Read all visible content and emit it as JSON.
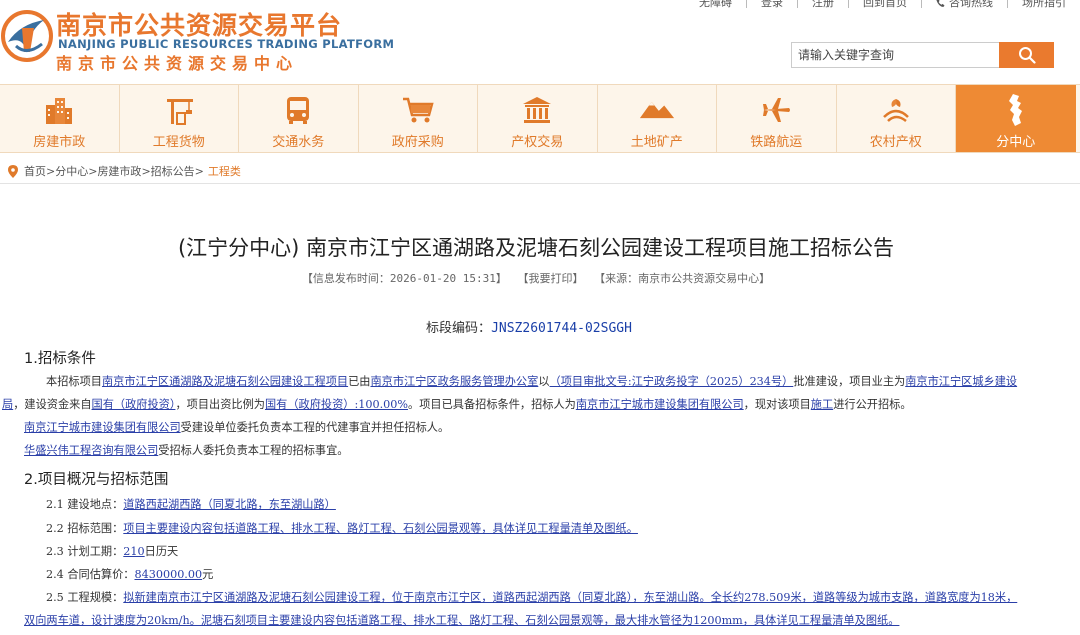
{
  "topbar": {
    "accessibility": "无障碍",
    "login": "登录",
    "register": "注册",
    "home": "回到首页",
    "hotline": "咨询热线",
    "venue_guide": "场所指引"
  },
  "brand": {
    "name_cn": "南京市公共资源交易平台",
    "name_en": "NANJING PUBLIC RESOURCES TRADING PLATFORM",
    "center_cn": "南京市公共资源交易中心"
  },
  "search": {
    "placeholder": "请输入关键字查询"
  },
  "nav": [
    {
      "label": "房建市政",
      "icon": "buildings-icon"
    },
    {
      "label": "工程货物",
      "icon": "crane-icon"
    },
    {
      "label": "交通水务",
      "icon": "bus-icon"
    },
    {
      "label": "政府采购",
      "icon": "cart-icon"
    },
    {
      "label": "产权交易",
      "icon": "bank-icon"
    },
    {
      "label": "土地矿产",
      "icon": "mountain-icon"
    },
    {
      "label": "铁路航运",
      "icon": "plane-icon"
    },
    {
      "label": "农村产权",
      "icon": "farm-icon"
    },
    {
      "label": "分中心",
      "icon": "map-icon"
    }
  ],
  "breadcrumb": {
    "items": [
      "首页",
      "分中心",
      "房建市政",
      "招标公告"
    ],
    "current": "工程类"
  },
  "article": {
    "title": "(江宁分中心) 南京市江宁区通湖路及泥塘石刻公园建设工程项目施工招标公告",
    "meta": {
      "publish_time": "【信息发布时间：2026-01-20 15:31】",
      "print": "【我要打印】",
      "source": "【来源：南京市公共资源交易中心】"
    },
    "section_code_label": "标段编码：",
    "section_code": "JNSZ2601744-02SGGH",
    "sec1_title": "1.招标条件",
    "sec1": {
      "t1": "本招标项目",
      "project_name": "南京市江宁区通湖路及泥塘石刻公园建设工程项目",
      "t2": "已由",
      "approver": "南京市江宁区政务服务管理办公室",
      "t3": "以",
      "approval_no": "（项目审批文号:江宁政务投字（2025）234号）",
      "t4": "批准建设，项目业主为",
      "owner_a": "南京市江宁区城乡建设",
      "owner_b": "局",
      "t5": "，建设资金来自",
      "fund": "国有（政府投资）",
      "t6": "，项目出资比例为",
      "ratio": "国有（政府投资）:100.00%",
      "t7": "。项目已具备招标条件，招标人为",
      "tenderer": "南京市江宁城市建设集团有限公司",
      "t8": "，现对该项目",
      "scope_word": "施工",
      "t9": "进行公开招标。",
      "line2_org": "南京江宁城市建设集团有限公司",
      "line2_text": "受建设单位委托负责本工程的代建事宜并担任招标人。",
      "line3_org": "华盛兴伟工程咨询有限公司",
      "line3_text": "受招标人委托负责本工程的招标事宜。"
    },
    "sec2_title": "2.项目概况与招标范围",
    "sec2": {
      "r1_label": "2.1 建设地点：",
      "r1_value": "道路西起湖西路（同夏北路，东至湖山路）",
      "r2_label": "2.2 招标范围：",
      "r2_value": "项目主要建设内容包括道路工程、排水工程、路灯工程、石刻公园景观等，具体详见工程量清单及图纸。",
      "r3_label": "2.3 计划工期：",
      "r3_value": "210",
      "r3_suffix": "日历天",
      "r4_label": "2.4 合同估算价：",
      "r4_value": "8430000.00",
      "r4_suffix": "元",
      "r5_label": "2.5 工程规模：",
      "r5_value_a": "拟新建南京市江宁区通湖路及泥塘石刻公园建设工程，位于南京市江宁区，道路西起湖西路（同夏北路），东至湖山路。全长约278.509米，道路等级为城市支路，道路宽度为18米，",
      "r5_value_b": "双向两车道，设计速度为20km/h。泥塘石刻项目主要建设内容包括道路工程、排水工程、路灯工程、石刻公园景观等，最大排水管径为1200mm，具体详见工程量清单及图纸。"
    }
  },
  "colors": {
    "accent": "#ea7a2e",
    "brand_blue": "#3a6f9f",
    "link": "#2a3fa8",
    "nav_bg": "#fdf5ea"
  }
}
